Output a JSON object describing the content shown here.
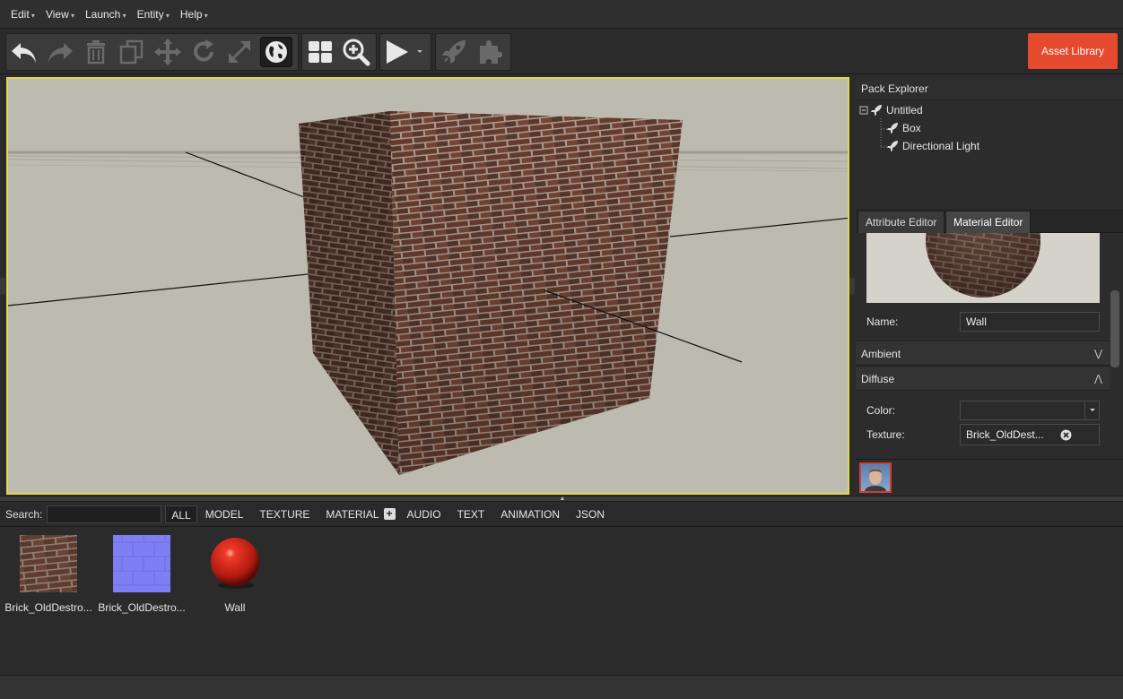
{
  "menu": [
    "Edit",
    "View",
    "Launch",
    "Entity",
    "Help"
  ],
  "toolbar": {
    "asset_library_label": "Asset Library",
    "icons": [
      "undo-icon",
      "redo-icon",
      "delete-icon",
      "duplicate-icon",
      "move-icon",
      "rotate-icon",
      "scale-icon",
      "world-space-icon",
      "grid-view-icon",
      "zoom-icon",
      "play-icon",
      "launch-icon",
      "plugin-icon"
    ],
    "colors": {
      "accent": "#e64a2e",
      "viewport_border": "#e1d84a"
    }
  },
  "pack_explorer": {
    "title": "Pack Explorer",
    "root": "Untitled",
    "children": [
      "Box",
      "Directional Light"
    ]
  },
  "tabs": {
    "attribute": "Attribute Editor",
    "material": "Material Editor"
  },
  "material_editor": {
    "name_label": "Name:",
    "name_value": "Wall",
    "ambient_label": "Ambient",
    "diffuse_label": "Diffuse",
    "color_label": "Color:",
    "texture_label": "Texture:",
    "texture_value": "Brick_OldDest..."
  },
  "assets": {
    "search_label": "Search:",
    "filters": [
      "ALL",
      "MODEL",
      "TEXTURE",
      "MATERIAL",
      "AUDIO",
      "TEXT",
      "ANIMATION",
      "JSON"
    ],
    "items": [
      {
        "name": "Brick_OldDestro..."
      },
      {
        "name": "Brick_OldDestro..."
      },
      {
        "name": "Wall"
      }
    ]
  }
}
